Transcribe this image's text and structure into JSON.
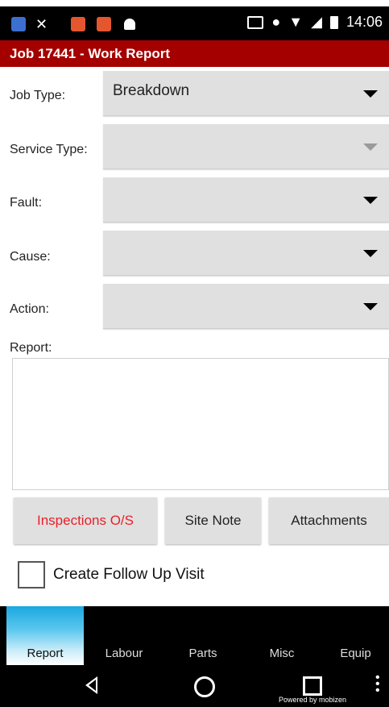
{
  "status_bar": {
    "time": "14:06",
    "icons": [
      "app-icon",
      "tools-icon",
      "notification-icon",
      "notification-icon",
      "android-icon",
      "cast-icon",
      "location-icon",
      "wifi-icon",
      "signal-icon",
      "battery-icon"
    ]
  },
  "title": "Job 17441 - Work Report",
  "fields": {
    "job_type": {
      "label": "Job Type:",
      "value": "Breakdown"
    },
    "service_type": {
      "label": "Service Type:",
      "value": ""
    },
    "fault": {
      "label": "Fault:",
      "value": ""
    },
    "cause": {
      "label": "Cause:",
      "value": ""
    },
    "action": {
      "label": "Action:",
      "value": ""
    },
    "report": {
      "label": "Report:",
      "value": ""
    }
  },
  "buttons": {
    "inspections": "Inspections O/S",
    "site_note": "Site Note",
    "attachments": "Attachments"
  },
  "follow_up": {
    "label": "Create Follow Up Visit",
    "checked": false
  },
  "tabs": [
    "Report",
    "Labour",
    "Parts",
    "Misc",
    "Equip"
  ],
  "active_tab": "Report",
  "watermark": "Powered by mobizen",
  "colors": {
    "title_bar": "#a50000",
    "inspections_text": "#e8202a",
    "active_tab": "#1ba8e0"
  }
}
